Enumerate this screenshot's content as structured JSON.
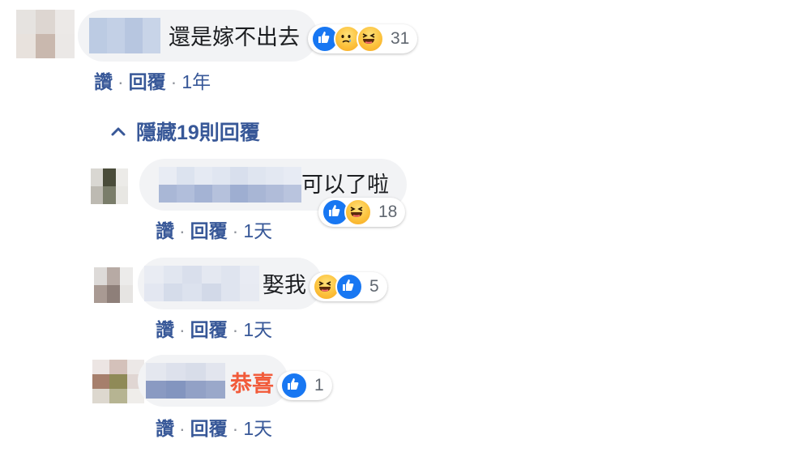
{
  "comments": [
    {
      "text": "還是嫁不出去",
      "reaction_count": "31",
      "like_label": "讚",
      "reply_label": "回覆",
      "time": "1年"
    },
    {
      "text": "可以了啦",
      "reaction_count": "18",
      "like_label": "讚",
      "reply_label": "回覆",
      "time": "1天"
    },
    {
      "text": "娶我",
      "reaction_count": "5",
      "like_label": "讚",
      "reply_label": "回覆",
      "time": "1天"
    },
    {
      "text": "恭喜",
      "reaction_count": "1",
      "like_label": "讚",
      "reply_label": "回覆",
      "time": "1天"
    }
  ],
  "replies_toggle": {
    "label": "隱藏19則回覆",
    "icon": "chevron-up-icon"
  },
  "separator": "·",
  "colors": {
    "link": "#385898",
    "bubble": "#f2f3f5",
    "like": "#1877f2",
    "highlight_text": "#f25b3a"
  }
}
